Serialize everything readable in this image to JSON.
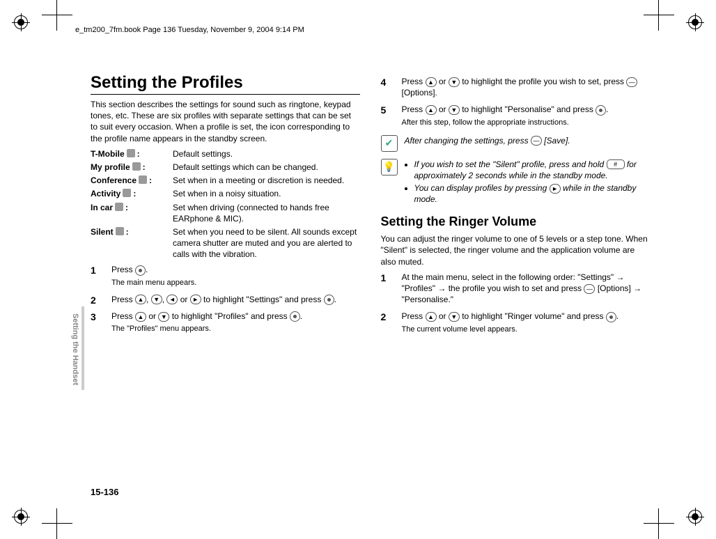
{
  "header": "e_tm200_7fm.book  Page 136  Tuesday, November 9, 2004  9:14 PM",
  "side_tab": "Setting the Handset",
  "page_number": "15-136",
  "col1": {
    "title": "Setting the Profiles",
    "intro": "This section describes the settings for sound such as ringtone, keypad tones, etc. These are six profiles with separate settings that can be set to suit every occasion. When a profile is set, the icon corresponding to the profile name appears in the standby screen.",
    "profiles": [
      {
        "name": "T-Mobile",
        "desc": "Default settings."
      },
      {
        "name": "My profile",
        "desc": "Default settings which can be changed."
      },
      {
        "name": "Conference",
        "desc": "Set when in a meeting or discretion is needed."
      },
      {
        "name": "Activity",
        "desc": "Set when in a noisy situation."
      },
      {
        "name": "In car",
        "desc": "Set when driving (connected to hands free EARphone & MIC)."
      },
      {
        "name": "Silent",
        "desc": "Set when you need to be silent. All sounds except camera shutter are muted and you are alerted to calls with the vibration."
      }
    ],
    "step1_a": "Press ",
    "step1_b": ".",
    "step1_sub": "The main menu appears.",
    "step2_a": "Press ",
    "step2_b": ", ",
    "step2_c": ", ",
    "step2_d": " or ",
    "step2_e": " to highlight \"Settings\" and press ",
    "step2_f": ".",
    "step3_a": "Press ",
    "step3_b": " or ",
    "step3_c": " to highlight \"Profiles\" and press ",
    "step3_d": ".",
    "step3_sub": "The \"Profiles\" menu appears."
  },
  "col2": {
    "step4_a": "Press ",
    "step4_b": " or ",
    "step4_c": " to highlight the profile you wish to set, press ",
    "step4_d": " [Options].",
    "step5_a": "Press ",
    "step5_b": " or ",
    "step5_c": " to highlight \"Personalise\" and press ",
    "step5_d": ".",
    "step5_sub": "After this step, follow the appropriate instructions.",
    "note1_a": "After changing the settings, press ",
    "note1_b": " [Save].",
    "note2_li1_a": "If you wish to set the \"Silent\" profile, press and hold ",
    "note2_li1_b": " for approximately 2 seconds while in the standby mode.",
    "note2_li2_a": "You can display profiles by pressing ",
    "note2_li2_b": " while in the standby mode.",
    "key_hash": "#",
    "h2": "Setting the Ringer Volume",
    "h2_intro": "You can adjust the ringer volume to one of 5 levels or a step tone. When \"Silent\" is selected, the ringer volume and the application volume are also muted.",
    "rstep1_a": "At the main menu, select in the following order: \"Settings\" → \"Profiles\" → the profile you wish to set and press ",
    "rstep1_b": " [Options] → \"Personalise.\"",
    "rstep2_a": "Press ",
    "rstep2_b": " or ",
    "rstep2_c": " to highlight \"Ringer volume\" and press ",
    "rstep2_d": ".",
    "rstep2_sub": "The current volume level appears."
  }
}
